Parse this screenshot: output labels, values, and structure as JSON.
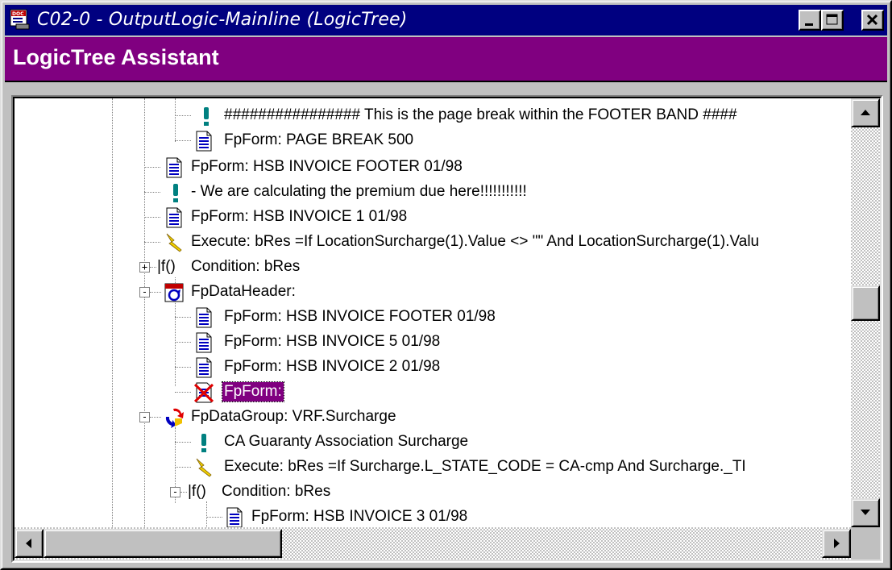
{
  "window": {
    "title": "C02-0 - OutputLogic-Mainline (LogicTree)",
    "app_icon": "doc-app-icon",
    "buttons": [
      "minimize",
      "maximize",
      "close"
    ]
  },
  "banner": {
    "title": "LogicTree Assistant"
  },
  "colors": {
    "titlebar": "#000080",
    "banner": "#800080",
    "selection": "#800080",
    "doc_icon": "#0000c0"
  },
  "tree": {
    "nodes": [
      {
        "label": "################ This is the page break within the FOOTER BAND ####",
        "icon": "exclamation-icon"
      },
      {
        "label": "FpForm: PAGE BREAK 500",
        "icon": "document-icon"
      },
      {
        "label": "FpForm: HSB INVOICE FOOTER 01/98",
        "icon": "document-icon"
      },
      {
        "label": "- We are calculating the premium due here!!!!!!!!!!!",
        "icon": "exclamation-icon"
      },
      {
        "label": "FpForm: HSB INVOICE 1 01/98",
        "icon": "document-icon"
      },
      {
        "label": "Execute: bRes =If LocationSurcharge(1).Value <> \"\" And LocationSurcharge(1).Valu",
        "icon": "lightning-icon"
      },
      {
        "label": "Condition: bRes",
        "icon": "condition-icon",
        "expander": "+"
      },
      {
        "label": "FpDataHeader:",
        "icon": "data-header-icon",
        "expander": "-"
      },
      {
        "label": "FpForm: HSB INVOICE FOOTER 01/98",
        "icon": "document-icon"
      },
      {
        "label": "FpForm: HSB INVOICE 5 01/98",
        "icon": "document-icon"
      },
      {
        "label": "FpForm: HSB INVOICE 2 01/98",
        "icon": "document-icon"
      },
      {
        "label": "FpForm:",
        "icon": "invalid-document-icon",
        "selected": true
      },
      {
        "label": "FpDataGroup: VRF.Surcharge",
        "icon": "data-group-icon",
        "expander": "-"
      },
      {
        "label": "CA Guaranty Association Surcharge",
        "icon": "exclamation-icon"
      },
      {
        "label": "Execute: bRes =If Surcharge.L_STATE_CODE = CA-cmp And Surcharge._TI",
        "icon": "lightning-icon"
      },
      {
        "label": "Condition: bRes",
        "icon": "condition-icon",
        "expander": "-"
      },
      {
        "label": "FpForm: HSB INVOICE 3 01/98",
        "icon": "document-icon"
      }
    ]
  },
  "scrollbars": {
    "vertical_position": 0.45,
    "horizontal_position": 0.0
  }
}
